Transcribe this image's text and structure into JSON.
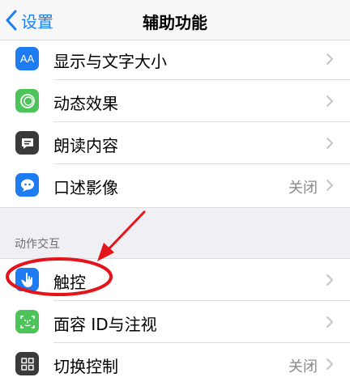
{
  "navbar": {
    "back_label": "设置",
    "title": "辅助功能"
  },
  "vision_rows": [
    {
      "label": "显示与文字大小",
      "value": "",
      "icon": "text-size-icon",
      "icon_color": "#1e7cf2"
    },
    {
      "label": "动态效果",
      "value": "",
      "icon": "motion-icon",
      "icon_color": "#4cc45a"
    },
    {
      "label": "朗读内容",
      "value": "",
      "icon": "speech-bubble-icon",
      "icon_color": "#3a3a3c"
    },
    {
      "label": "口述影像",
      "value": "关闭",
      "icon": "audio-description-icon",
      "icon_color": "#1e7cf2"
    }
  ],
  "section_header": "动作交互",
  "interaction_rows": [
    {
      "label": "触控",
      "value": "",
      "icon": "touch-hand-icon",
      "icon_color": "#1e7cf2"
    },
    {
      "label": "面容 ID与注视",
      "value": "",
      "icon": "face-id-icon",
      "icon_color": "#4cc45a"
    },
    {
      "label": "切换控制",
      "value": "关闭",
      "icon": "switch-control-icon",
      "icon_color": "#3a3a3c"
    }
  ],
  "annotation_color": "#e5141b"
}
